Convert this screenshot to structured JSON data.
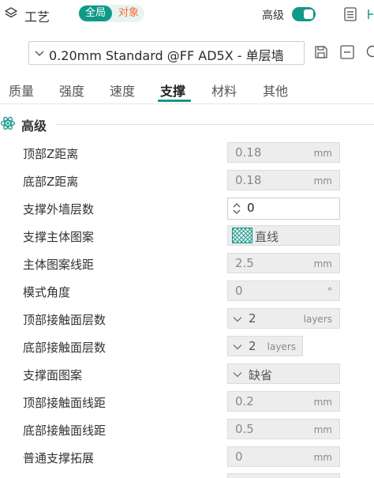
{
  "header": {
    "panel_title": "工艺",
    "scope_global": "全局",
    "scope_object": "对象",
    "advanced_label": "高级",
    "advanced_on": true,
    "accent": "#119988",
    "object_color": "#ff6a2a"
  },
  "preset": {
    "name": "0.20mm Standard @FF AD5X - 单层墙"
  },
  "tabs": [
    {
      "label": "质量",
      "active": false
    },
    {
      "label": "强度",
      "active": false
    },
    {
      "label": "速度",
      "active": false
    },
    {
      "label": "支撑",
      "active": true
    },
    {
      "label": "材料",
      "active": false
    },
    {
      "label": "其他",
      "active": false
    }
  ],
  "section": {
    "title": "高级"
  },
  "rows": [
    {
      "label": "顶部Z距离",
      "value": "0.18",
      "unit": "mm"
    },
    {
      "label": "底部Z距离",
      "value": "0.18",
      "unit": "mm"
    },
    {
      "label": "支撑外墙层数",
      "value": "0",
      "unit": ""
    },
    {
      "label": "支撑主体图案",
      "value": "直线",
      "unit": ""
    },
    {
      "label": "主体图案线距",
      "value": "2.5",
      "unit": "mm"
    },
    {
      "label": "模式角度",
      "value": "0",
      "unit": "°"
    },
    {
      "label": "顶部接触面层数",
      "value": "2",
      "unit": "layers"
    },
    {
      "label": "底部接触面层数",
      "value": "2",
      "unit": "layers"
    },
    {
      "label": "支撑面图案",
      "value": "缺省",
      "unit": ""
    },
    {
      "label": "顶部接触面线距",
      "value": "0.2",
      "unit": "mm"
    },
    {
      "label": "底部接触面线距",
      "value": "0.5",
      "unit": "mm"
    },
    {
      "label": "普通支撑拓展",
      "value": "0",
      "unit": "mm"
    }
  ],
  "icons": {
    "panel": "layers-icon",
    "toolbar_right": "list-icon",
    "save": "save-icon",
    "collapse": "minus-box-icon",
    "search": "search-icon",
    "section": "atom-icon",
    "pattern": "hatch-pattern-icon"
  }
}
